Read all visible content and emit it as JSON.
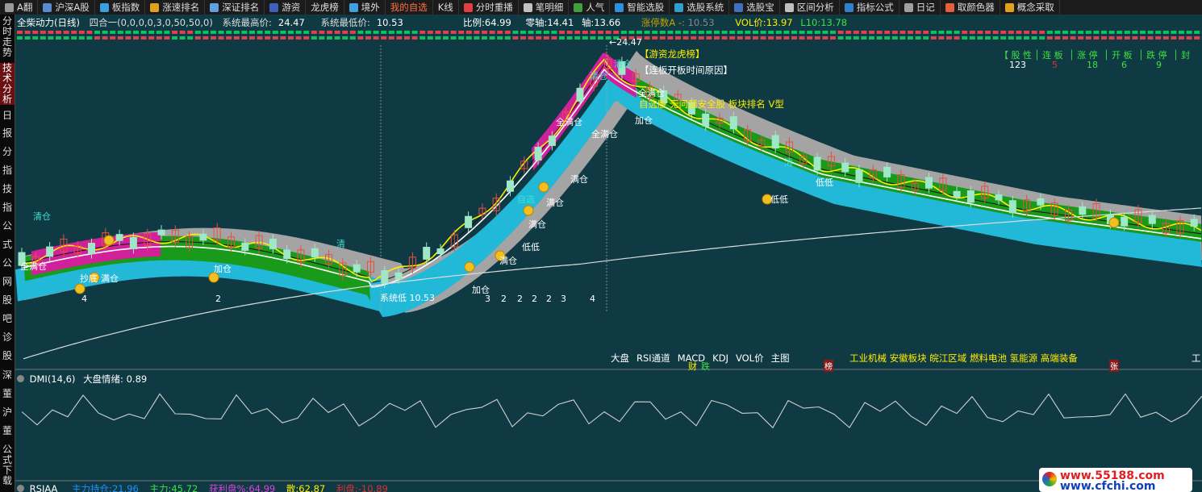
{
  "toolbar": {
    "items": [
      {
        "label": "A翻",
        "color": "#999999"
      },
      {
        "label": "沪深A股",
        "color": "#5a8ad0"
      },
      {
        "label": "板指数",
        "color": "#3aa0e0"
      },
      {
        "label": "涨速排名",
        "color": "#e0a020"
      },
      {
        "label": "深证排名",
        "color": "#60a0e0"
      },
      {
        "label": "游资",
        "color": "#4060c0"
      },
      {
        "label": "龙虎榜",
        "color": ""
      },
      {
        "label": "境外",
        "color": "#40a0e0"
      },
      {
        "label": "我的自选",
        "color": "",
        "active": true
      },
      {
        "label": "K线",
        "color": ""
      },
      {
        "label": "分时重播",
        "color": "#e04040"
      },
      {
        "label": "笔明细",
        "color": "#c0c0c0"
      },
      {
        "label": "人气",
        "color": "#40a040"
      },
      {
        "label": "智能选股",
        "color": "#3090e0"
      },
      {
        "label": "选股系统",
        "color": "#30a0d0"
      },
      {
        "label": "选股宝",
        "color": "#4070c0"
      },
      {
        "label": "区间分析",
        "color": "#c0c0c0"
      },
      {
        "label": "指标公式",
        "color": "#3080d0"
      },
      {
        "label": "日记",
        "color": "#a0a0a0"
      },
      {
        "label": "取颜色器",
        "color": "#e06040"
      },
      {
        "label": "概念采取",
        "color": "#e0a020"
      }
    ]
  },
  "leftbar": {
    "items": [
      "分时走势",
      "技术分析",
      "日",
      "报",
      "分",
      "指",
      "技",
      "指",
      "公",
      "式",
      "公",
      "网",
      "股",
      "吧",
      "诊",
      "股",
      "深",
      "董",
      "沪",
      "董",
      "公式下载"
    ]
  },
  "header": {
    "stock_name": "全柴动力(日线)",
    "indicator": "四合一(0,0,0,0,3,0,50,50,0)",
    "high_label": "系统最高价:",
    "high_value": "24.47",
    "low_label": "系统最低价:",
    "low_value": "10.53",
    "ratio_label": "比例:",
    "ratio_value": "64.99",
    "zero_label": "零轴:",
    "zero_value": "14.41",
    "axis_label": "轴:",
    "axis_value": "13.66",
    "limit_label": "涨停数A -",
    "limit_value": ": 10.53",
    "vol_label": "VOL价:",
    "vol_value": "13.97",
    "l10_label": "L10:",
    "l10_value": "13.78"
  },
  "main_chart": {
    "peak_label": "24.47",
    "low_label": "系统低 10.53",
    "dragon_tag": "【游资龙虎榜】",
    "reason_tag": "【连板开板时间原因】",
    "note": "自选股 无问题安全股 板块排名 V型",
    "stats_headers": [
      "【 股 性",
      "│ 连 板",
      "│ 涨 停",
      "│ 开 板",
      "│ 跌 停",
      "│ 封"
    ],
    "stats_values": [
      "123",
      "5",
      "18",
      "6",
      "9"
    ],
    "annotations": [
      {
        "text": "清仓",
        "color": "#40e0d0"
      },
      {
        "text": "全满仓",
        "color": "#ffffff"
      },
      {
        "text": "抄底",
        "color": "#ffffff"
      },
      {
        "text": "满仓",
        "color": "#ffffff"
      },
      {
        "text": "加仓",
        "color": "#ffffff"
      },
      {
        "text": "清",
        "color": "#40e0d0"
      },
      {
        "text": "满仓",
        "color": "#ffffff"
      },
      {
        "text": "加仓",
        "color": "#ffffff"
      },
      {
        "text": "低低",
        "color": "#ffffff"
      },
      {
        "text": "满仓",
        "color": "#ffffff"
      },
      {
        "text": "满仓",
        "color": "#ffffff"
      },
      {
        "text": "满仓",
        "color": "#ffffff"
      },
      {
        "text": "自选",
        "color": "#40e0d0"
      },
      {
        "text": "全满仓",
        "color": "#ffffff"
      },
      {
        "text": "全满仓",
        "color": "#ffffff"
      },
      {
        "text": "清仓",
        "color": "#40e0d0"
      },
      {
        "text": "全满仓",
        "color": "#ffffff"
      },
      {
        "text": "加仓",
        "color": "#ffffff"
      },
      {
        "text": "清仓",
        "color": "#40e0d0"
      },
      {
        "text": "低低",
        "color": "#ffffff"
      },
      {
        "text": "清",
        "color": "#40e0d0"
      },
      {
        "text": "低低",
        "color": "#ffffff"
      }
    ],
    "counts": [
      "4",
      "2",
      "3",
      "2",
      "2",
      "2",
      "2",
      "3",
      "4"
    ],
    "bottom_tabs": [
      "大盘",
      "RSI通道",
      "MACD",
      "KDJ",
      "VOL价",
      "主图"
    ],
    "bottom_marks": [
      "财",
      "跌",
      "榜",
      "张"
    ],
    "sectors": "工业机械 安徽板块 皖江区域 燃料电池 氢能源 高端装备",
    "right_edge": "工"
  },
  "dmi_panel": {
    "title": "DMI(14,6)",
    "mood_label": "大盘情绪:",
    "mood_value": "0.89"
  },
  "rsi_panel": {
    "title": "RSIAA",
    "main_label": "主力持仓:",
    "main_value": "21.96",
    "force_label": "主力:",
    "force_value": "45.72",
    "profit_label": "获利盘%:",
    "profit_value": "64.99",
    "loose_label": "散:",
    "loose_value": "62.87",
    "bull_label": "利盘:",
    "bull_value": "-10.89"
  },
  "watermark": {
    "line1": "www.55188.com",
    "line2": "www.cfchi.com"
  },
  "colors": {
    "bg_panel": "#0f3a44",
    "ribbon_pink": "#d0209a",
    "ribbon_green": "#1a9a1a",
    "band_cyan": "#22b8d8",
    "band_gray": "#a4a4a4",
    "price_yellow": "#ffee00",
    "candle_green": "#9ee8c8",
    "candle_red": "#e85040"
  }
}
